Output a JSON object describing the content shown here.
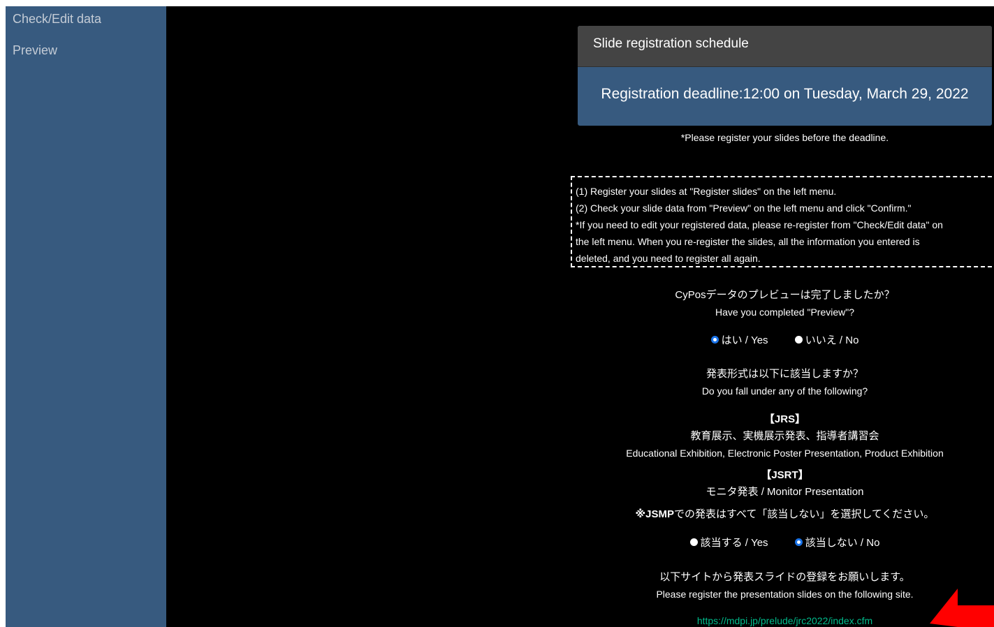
{
  "sidebar": {
    "items": [
      {
        "label": "Check/Edit data"
      },
      {
        "label": "Preview"
      }
    ]
  },
  "schedule": {
    "header": "Slide registration schedule",
    "deadline": "Registration deadline:12:00 on Tuesday, March 29, 2022",
    "note": "*Please register your slides before the deadline."
  },
  "steps": {
    "line1": "(1) Register your slides at \"Register slides\" on the left menu.",
    "line2": "(2) Check your slide data from \"Preview\" on the left menu and click \"Confirm.\"",
    "line3": "*If you need to edit your registered data, please re-register from \"Check/Edit data\" on",
    "line4": "the left menu. When you re-register the slides, all the information you entered is",
    "line5": "deleted, and you need to register all again."
  },
  "preview_question": {
    "jp": "CyPosデータのプレビューは完了しましたか？",
    "en": "Have you completed \"Preview\"?",
    "options": [
      {
        "label": "はい / Yes",
        "checked": true
      },
      {
        "label": "いいえ / No",
        "checked": false
      }
    ]
  },
  "format_question": {
    "jp": "発表形式は以下に該当しますか？",
    "en": "Do you fall under any of the following?",
    "jrs_heading": "【JRS】",
    "jrs_jp": "教育展示、実機展示発表、指導者講習会",
    "jrs_en": "Educational Exhibition, Electronic Poster Presentation, Product Exhibition",
    "jsrt_heading": "【JSRT】",
    "jsrt_text": "モニタ発表 / Monitor Presentation",
    "jsmp_bold": "※JSMP",
    "jsmp_rest": "での発表はすべて「該当しない」を選択してください。",
    "options": [
      {
        "label": "該当する / Yes",
        "checked": false
      },
      {
        "label": "該当しない / No",
        "checked": true
      }
    ]
  },
  "register": {
    "jp": "以下サイトから発表スライドの登録をお願いします。",
    "en": "Please register the presentation slides on the following site.",
    "link": "https://mdpi.jp/prelude/jrc2022/index.cfm"
  },
  "colors": {
    "sidebar": "#375a7f",
    "card_header": "#444444",
    "link": "#00bc8c",
    "arrow": "#ff0000",
    "radio_checked": "#1a73e8"
  }
}
